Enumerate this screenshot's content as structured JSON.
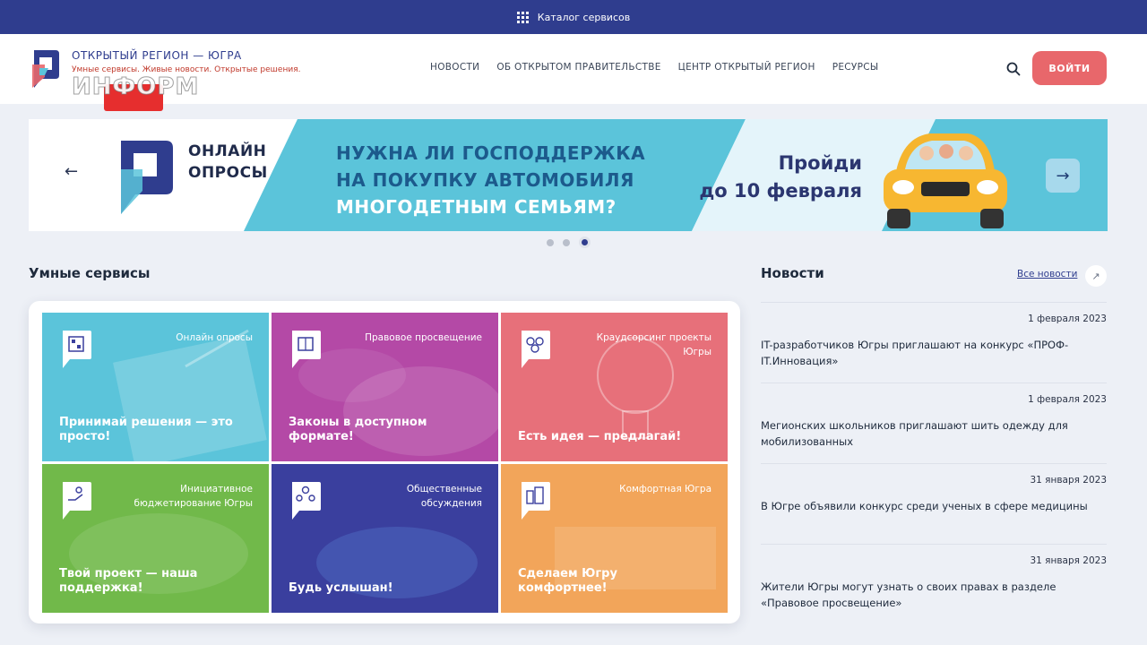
{
  "topbar": {
    "icon": "grid-icon",
    "label": "Каталог сервисов"
  },
  "header": {
    "brand_title": "ОТКРЫТЫЙ РЕГИОН — ЮГРА",
    "brand_sub": "Умные сервисы. Живые новости. Открытые решения.",
    "watermark": "ИНФОРМ",
    "nav": [
      "НОВОСТИ",
      "ОБ ОТКРЫТОМ ПРАВИТЕЛЬСТВЕ",
      "ЦЕНТР ОТКРЫТЫЙ РЕГИОН",
      "РЕСУРСЫ"
    ],
    "login": "ВОЙТИ",
    "colors": {
      "brand": "#2f3d8e",
      "accent": "#e8676b"
    }
  },
  "banner": {
    "online": [
      "ОНЛАЙН",
      "ОПРОСЫ"
    ],
    "question": [
      "НУЖНА ЛИ ГОСПОДДЕРЖКА",
      "НА ПОКУПКУ АВТОМОБИЛЯ",
      "МНОГОДЕТНЫМ СЕМЬЯМ?"
    ],
    "cta": [
      "Пройди",
      "до 10 февраля"
    ],
    "prev": "←",
    "next": "→",
    "slides_total": 3,
    "active_slide": 3
  },
  "services": {
    "title": "Умные сервисы",
    "tiles": [
      {
        "label": "Онлайн опросы",
        "title": "Принимай решения — это просто!",
        "color": "#5bc4da"
      },
      {
        "label": "Правовое просвещение",
        "title": "Законы в доступном формате!",
        "color": "#b449a6"
      },
      {
        "label": "Краудсорсинг проекты Югры",
        "title": "Есть идея — предлагай!",
        "color": "#e7707a"
      },
      {
        "label": "Инициативное бюджетирование Югры",
        "title": "Твой проект — наша поддержка!",
        "color": "#71b94a"
      },
      {
        "label": "Общественные обсуждения",
        "title": "Будь услышан!",
        "color": "#3a3f9e"
      },
      {
        "label": "Комфортная Югра",
        "title": "Сделаем Югру комфортнее!",
        "color": "#f2a55a"
      }
    ]
  },
  "news": {
    "title": "Новости",
    "all": "Все новости",
    "all_icon": "↗",
    "items": [
      {
        "date": "1 февраля 2023",
        "text": "IT-разработчиков Югры приглашают на конкурс «ПРОФ-IT.Инновация»"
      },
      {
        "date": "1 февраля 2023",
        "text": "Мегионских школьников приглашают шить одежду для мобилизованных"
      },
      {
        "date": "31 января 2023",
        "text": "В Югре объявили конкурс среди ученых в сфере медицины"
      },
      {
        "date": "31 января 2023",
        "text": "Жители Югры могут узнать о своих правах в разделе «Правовое просвещение»"
      }
    ]
  }
}
